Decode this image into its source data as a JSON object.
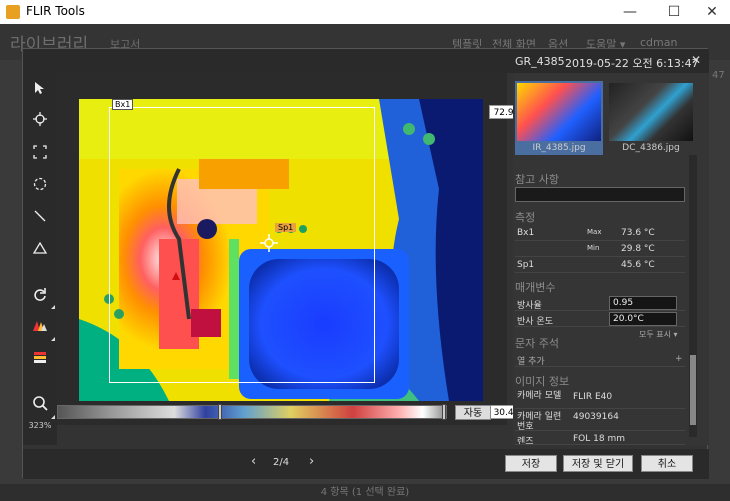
{
  "app": {
    "title": "FLIR Tools"
  },
  "window_controls": {
    "minimize": "—",
    "maximize": "☐",
    "close": "✕"
  },
  "background": {
    "library": "라이브러리",
    "report": "보고서",
    "nav": [
      "템플릿",
      "전체 화면",
      "옵션",
      "도움말 ▾",
      "cdman"
    ],
    "status": "4 항목 (1 선택 완료)",
    "side_number": "47"
  },
  "dialog": {
    "filename": "GR_4385",
    "datetime": "2019-05-22 오전 6:13:47",
    "close": "✕"
  },
  "toolbar": {
    "zoom": "323%"
  },
  "thermal": {
    "max_temp": "72.9°C",
    "min_temp": "30.4°C",
    "box_label": "Bx1",
    "spot_label": "Sp1",
    "auto_button": "자동"
  },
  "thumbnails": [
    {
      "caption": "IR_4385.jpg",
      "selected": true
    },
    {
      "caption": "DC_4386.jpg",
      "selected": false
    }
  ],
  "panel": {
    "notes_title": "참고 사항",
    "measure_title": "측정",
    "measurements": [
      {
        "name": "Bx1",
        "kind": "Max",
        "value": "73.6 °C"
      },
      {
        "name": "",
        "kind": "Min",
        "value": "29.8 °C"
      },
      {
        "name": "Sp1",
        "kind": "",
        "value": "45.6 °C"
      }
    ],
    "params_title": "매개변수",
    "params": [
      {
        "label": "방사율",
        "value": "0.95"
      },
      {
        "label": "반사 온도",
        "value": "20.0°C"
      }
    ],
    "show_all": "모두 표시 ▾",
    "text_title": "문자 주석",
    "add_column": "열 추가",
    "add_icon": "+",
    "info_title": "이미지 정보",
    "info": [
      {
        "label": "카메라 모델",
        "value": "FLIR E40"
      },
      {
        "label": "카메라 일련 번호",
        "value": "49039164"
      },
      {
        "label": "렌즈",
        "value": "FOL 18 mm"
      }
    ]
  },
  "footer": {
    "prev": "‹",
    "page": "2/4",
    "next": "›",
    "save": "저장",
    "save_close": "저장 및 닫기",
    "cancel": "취소"
  },
  "colors": {
    "accent_selected": "#4a6ea0",
    "spot_label_bg": "#e8a040"
  }
}
